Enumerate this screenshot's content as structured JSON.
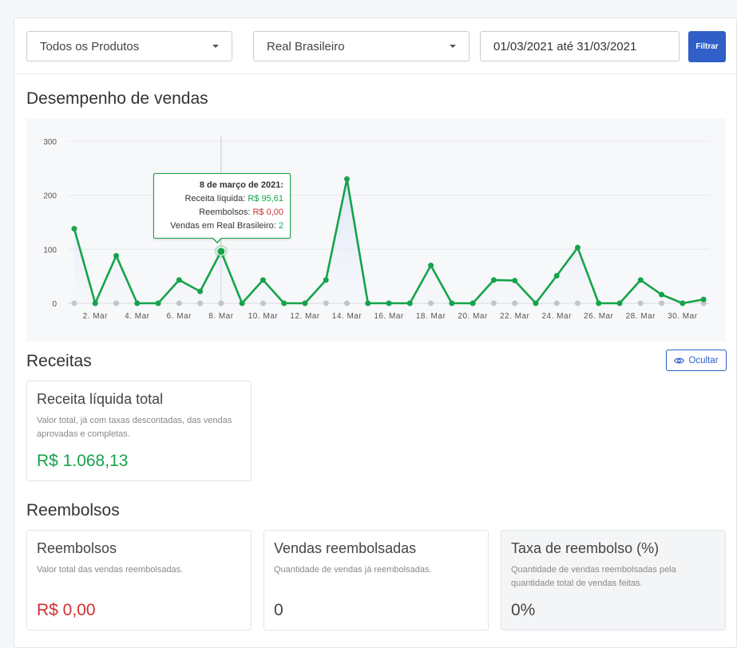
{
  "filters": {
    "product_select": "Todos os Produtos",
    "currency_select": "Real Brasileiro",
    "date_range": "01/03/2021 até 31/03/2021",
    "filter_button": "Filtrar"
  },
  "performance": {
    "title": "Desempenho de vendas",
    "tooltip": {
      "title": "8 de março de 2021:",
      "net_label": "Receita líquida:",
      "net_value": "R$ 95,61",
      "refunds_label": "Reembolsos:",
      "refunds_value": "R$ 0,00",
      "sales_label": "Vendas em Real Brasileiro:",
      "sales_value": "2"
    }
  },
  "chart_data": {
    "type": "line",
    "x": [
      1,
      2,
      3,
      4,
      5,
      6,
      7,
      8,
      9,
      10,
      11,
      12,
      13,
      14,
      15,
      16,
      17,
      18,
      19,
      20,
      21,
      22,
      23,
      24,
      25,
      26,
      27,
      28,
      29,
      30,
      31
    ],
    "x_tick_labels": [
      "2. Mar",
      "4. Mar",
      "6. Mar",
      "8. Mar",
      "10. Mar",
      "12. Mar",
      "14. Mar",
      "16. Mar",
      "18. Mar",
      "20. Mar",
      "22. Mar",
      "24. Mar",
      "26. Mar",
      "28. Mar",
      "30. Mar"
    ],
    "y_ticks": [
      "0",
      "100",
      "200",
      "300"
    ],
    "ylim": [
      0,
      300
    ],
    "series": [
      {
        "values": [
          138,
          0,
          88,
          0,
          0,
          43,
          22,
          96,
          0,
          43,
          0,
          0,
          43,
          230,
          0,
          0,
          0,
          70,
          0,
          0,
          43,
          42,
          0,
          51,
          103,
          0,
          0,
          43,
          16,
          0,
          7
        ],
        "color": "#16a34a"
      },
      {
        "values": [
          0,
          0,
          0,
          0,
          0,
          0,
          0,
          0,
          0,
          0,
          0,
          0,
          0,
          0,
          0,
          0,
          0,
          0,
          0,
          0,
          0,
          0,
          0,
          0,
          0,
          0,
          0,
          0,
          0,
          0,
          0
        ],
        "color": "#c2c5cc"
      }
    ],
    "highlight_index": 7,
    "grid": true,
    "legend": "none"
  },
  "revenue": {
    "title": "Receitas",
    "hide_button": "Ocultar",
    "hide_icon": "eye-icon",
    "card": {
      "title": "Receita líquida total",
      "desc": "Valor total, já com taxas descontadas, das vendas aprovadas e completas.",
      "value": "R$ 1.068,13"
    }
  },
  "refunds": {
    "title": "Reembolsos",
    "cards": [
      {
        "title": "Reembolsos",
        "desc": "Valor total das vendas reembolsadas.",
        "value": "R$ 0,00"
      },
      {
        "title": "Vendas reembolsadas",
        "desc": "Quantidade de vendas já reembolsadas.",
        "value": "0"
      },
      {
        "title": "Taxa de reembolso (%)",
        "desc": "Quantidade de vendas reembolsadas pela quantidade total de vendas feitas.",
        "value": "0%"
      }
    ]
  },
  "colors": {
    "accent": "#2f5fc7",
    "positive": "#16a34a",
    "negative": "#d32f2f"
  }
}
